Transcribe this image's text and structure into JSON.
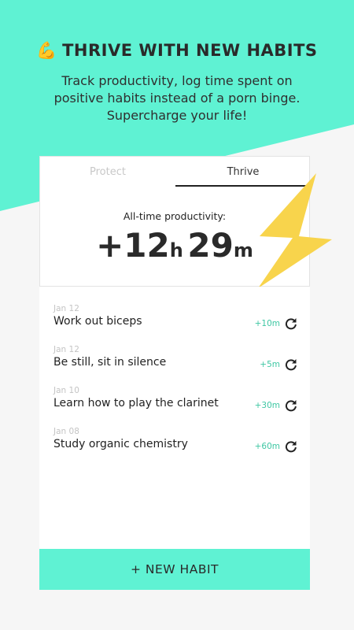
{
  "colors": {
    "accent": "#5ff2d3",
    "bolt": "#f8d44c",
    "gain": "#3ec7a3"
  },
  "hero": {
    "emoji": "💪",
    "title": "THRIVE WITH NEW HABITS",
    "subtitle_lines": [
      "Track productivity, log time spent on",
      "positive habits instead of a porn binge.",
      "Supercharge your life!"
    ]
  },
  "tabs": [
    {
      "label": "Protect",
      "active": false
    },
    {
      "label": "Thrive",
      "active": true
    }
  ],
  "productivity": {
    "label": "All-time productivity:",
    "sign_hours": "+12",
    "hours_unit": "h",
    "minutes": "29",
    "minutes_unit": "m"
  },
  "habits": [
    {
      "date": "Jan 12",
      "name": "Work out biceps",
      "gain": "+10m"
    },
    {
      "date": "Jan 12",
      "name": "Be still, sit in silence",
      "gain": "+5m"
    },
    {
      "date": "Jan 10",
      "name": "Learn how to play the clarinet",
      "gain": "+30m"
    },
    {
      "date": "Jan 08",
      "name": "Study organic chemistry",
      "gain": "+60m"
    }
  ],
  "new_habit_label": "+ NEW HABIT"
}
